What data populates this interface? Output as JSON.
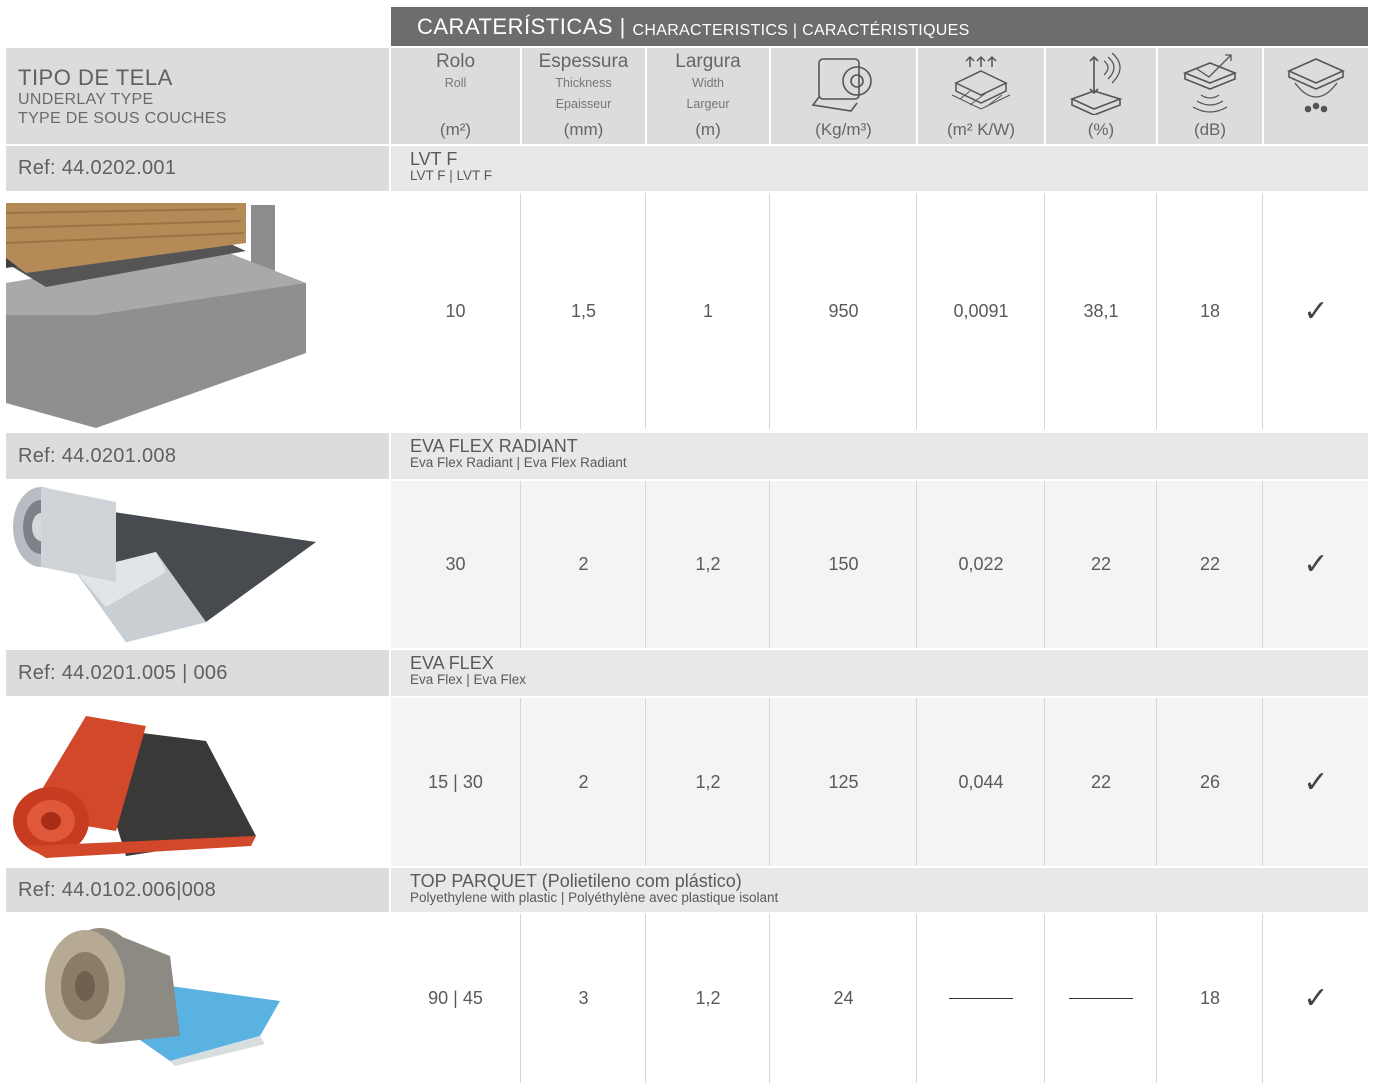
{
  "banner": {
    "main": "CARATERÍSTICAS",
    "sep": " | ",
    "en": "CHARACTERISTICS",
    "fr": "CARACTÉRISTIQUES"
  },
  "header": {
    "left": {
      "pt": "TIPO DE TELA",
      "en": "UNDERLAY TYPE",
      "fr": "TYPE DE SOUS COUCHES"
    },
    "columns": [
      {
        "pt": "Rolo",
        "en": "Roll",
        "fr": "",
        "unit": "(m²)",
        "icon": ""
      },
      {
        "pt": "Espessura",
        "en": "Thickness",
        "fr": "Epaisseur",
        "unit": "(mm)",
        "icon": ""
      },
      {
        "pt": "Largura",
        "en": "Width",
        "fr": "Largeur",
        "unit": "(m)",
        "icon": ""
      },
      {
        "pt": "",
        "en": "",
        "fr": "",
        "unit": "(Kg/m³)",
        "icon": "roll-density-icon"
      },
      {
        "pt": "",
        "en": "",
        "fr": "",
        "unit": "(m² K/W)",
        "icon": "thermal-resistance-icon"
      },
      {
        "pt": "",
        "en": "",
        "fr": "",
        "unit": "(%)",
        "icon": "compression-icon"
      },
      {
        "pt": "",
        "en": "",
        "fr": "",
        "unit": "(dB)",
        "icon": "sound-reduction-icon"
      },
      {
        "pt": "",
        "en": "",
        "fr": "",
        "unit": "",
        "icon": "moisture-barrier-icon"
      }
    ]
  },
  "products": [
    {
      "ref": "Ref: 44.0202.001",
      "name": "LVT F",
      "subname": "LVT F | LVT F",
      "image": "floor-section-image",
      "values": [
        "10",
        "1,5",
        "1",
        "950",
        "0,0091",
        "38,1",
        "18",
        "✓"
      ]
    },
    {
      "ref": "Ref: 44.0201.008",
      "name": "EVA FLEX RADIANT",
      "subname": "Eva Flex Radiant | Eva Flex Radiant",
      "image": "silver-roll-image",
      "values": [
        "30",
        "2",
        "1,2",
        "150",
        "0,022",
        "22",
        "22",
        "✓"
      ]
    },
    {
      "ref": "Ref: 44.0201.005 | 006",
      "name": "EVA FLEX",
      "subname": "Eva Flex | Eva Flex",
      "image": "red-roll-image",
      "values": [
        "15 | 30",
        "2",
        "1,2",
        "125",
        "0,044",
        "22",
        "26",
        "✓"
      ]
    },
    {
      "ref": "Ref: 44.0102.006|008",
      "name": "TOP PARQUET (Polietileno com plástico)",
      "subname": "Polyethylene with plastic | Polyéthylène avec plastique isolant",
      "image": "blue-roll-image",
      "values": [
        "90 | 45",
        "3",
        "1,2",
        "24",
        "—",
        "—",
        "18",
        "✓"
      ]
    }
  ]
}
